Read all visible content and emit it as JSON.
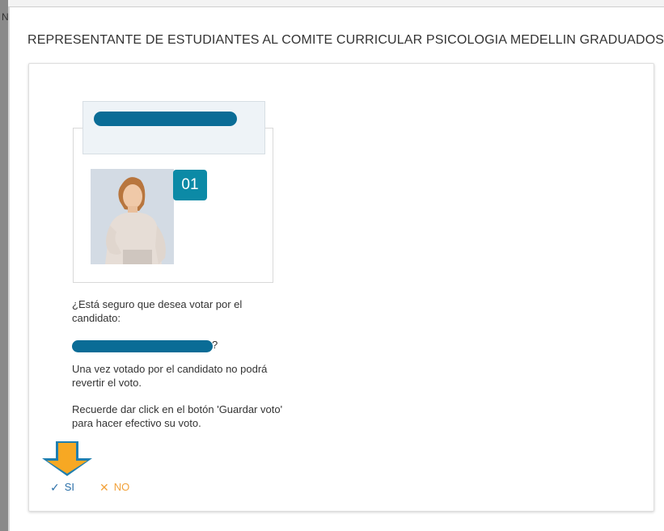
{
  "top_char": "N",
  "modal": {
    "title": "REPRESENTANTE DE ESTUDIANTES AL COMITE CURRICULAR PSICOLOGIA MEDELLIN GRADUADOS",
    "close_glyph": "×"
  },
  "candidate": {
    "number": "01",
    "photo_icon": "candidate-photo"
  },
  "confirm": {
    "question": "¿Está seguro que desea votar por el candidato:",
    "question_suffix": "?",
    "warning": "Una vez votado por el candidato no podrá revertir el voto.",
    "reminder": "Recuerde dar click en el botón 'Guardar voto' para hacer efectivo su voto."
  },
  "actions": {
    "yes_label": "SI",
    "yes_icon": "check-icon",
    "no_label": "NO",
    "no_icon": "x-icon"
  },
  "colors": {
    "accent": "#0a6c96",
    "badge": "#0c8aa6",
    "yes": "#2a6fa8",
    "no": "#f2a23b",
    "arrow": "#f7a823"
  }
}
